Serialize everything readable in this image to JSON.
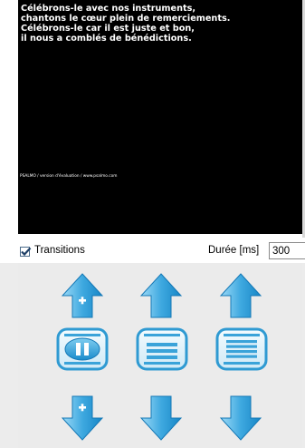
{
  "preview": {
    "lyrics": [
      "Célébrons-le avec nos instruments,",
      "chantons le cœur plein de remerciements.",
      "Célébrons-le car il est juste et bon,",
      "il nous a comblés de bénédictions."
    ],
    "watermark": "PSALMO / version d'évaluation / www.psalmo.com"
  },
  "options": {
    "transitions_label": "Transitions",
    "transitions_checked": true,
    "duration_label": "Durée [ms]",
    "duration_value": "300"
  },
  "controls": {
    "up_buttons": [
      "verse-up-add-icon",
      "arrow-up-icon",
      "arrow-up-icon"
    ],
    "middle_buttons": [
      "pause-icon",
      "lines-few-icon",
      "lines-many-icon"
    ],
    "down_buttons": [
      "verse-down-add-icon",
      "arrow-down-icon",
      "arrow-down-icon"
    ]
  },
  "colors": {
    "arrow_light": "#8fd3f4",
    "arrow_dark": "#1a90cf",
    "card_border": "#2f9ad2",
    "card_fill": "#dff1f9"
  }
}
